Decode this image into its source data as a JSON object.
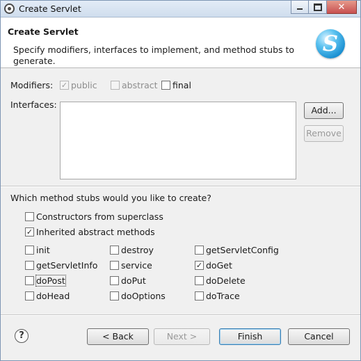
{
  "window": {
    "title": "Create Servlet",
    "close_label": "✕"
  },
  "header": {
    "title": "Create Servlet",
    "description": "Specify modifiers, interfaces to implement, and method stubs to generate.",
    "logo_letter": "S"
  },
  "modifiers": {
    "label": "Modifiers:",
    "public": {
      "label": "public",
      "checked": true,
      "enabled": false
    },
    "abstract": {
      "label": "abstract",
      "checked": false,
      "enabled": false
    },
    "final": {
      "label": "final",
      "checked": false,
      "enabled": true
    }
  },
  "interfaces": {
    "label": "Interfaces:",
    "add_label": "Add...",
    "remove_label": "Remove"
  },
  "stubs": {
    "question": "Which method stubs would you like to create?",
    "constructors": {
      "label": "Constructors from superclass",
      "checked": false
    },
    "inherited": {
      "label": "Inherited abstract methods",
      "checked": true
    },
    "methods": [
      {
        "label": "init",
        "checked": false
      },
      {
        "label": "destroy",
        "checked": false
      },
      {
        "label": "getServletConfig",
        "checked": false
      },
      {
        "label": "getServletInfo",
        "checked": false
      },
      {
        "label": "service",
        "checked": false
      },
      {
        "label": "doGet",
        "checked": true
      },
      {
        "label": "doPost",
        "checked": false
      },
      {
        "label": "doPut",
        "checked": false
      },
      {
        "label": "doDelete",
        "checked": false
      },
      {
        "label": "doHead",
        "checked": false
      },
      {
        "label": "doOptions",
        "checked": false
      },
      {
        "label": "doTrace",
        "checked": false
      }
    ]
  },
  "footer": {
    "help_symbol": "?",
    "back_label": "< Back",
    "next_label": "Next >",
    "finish_label": "Finish",
    "cancel_label": "Cancel"
  }
}
